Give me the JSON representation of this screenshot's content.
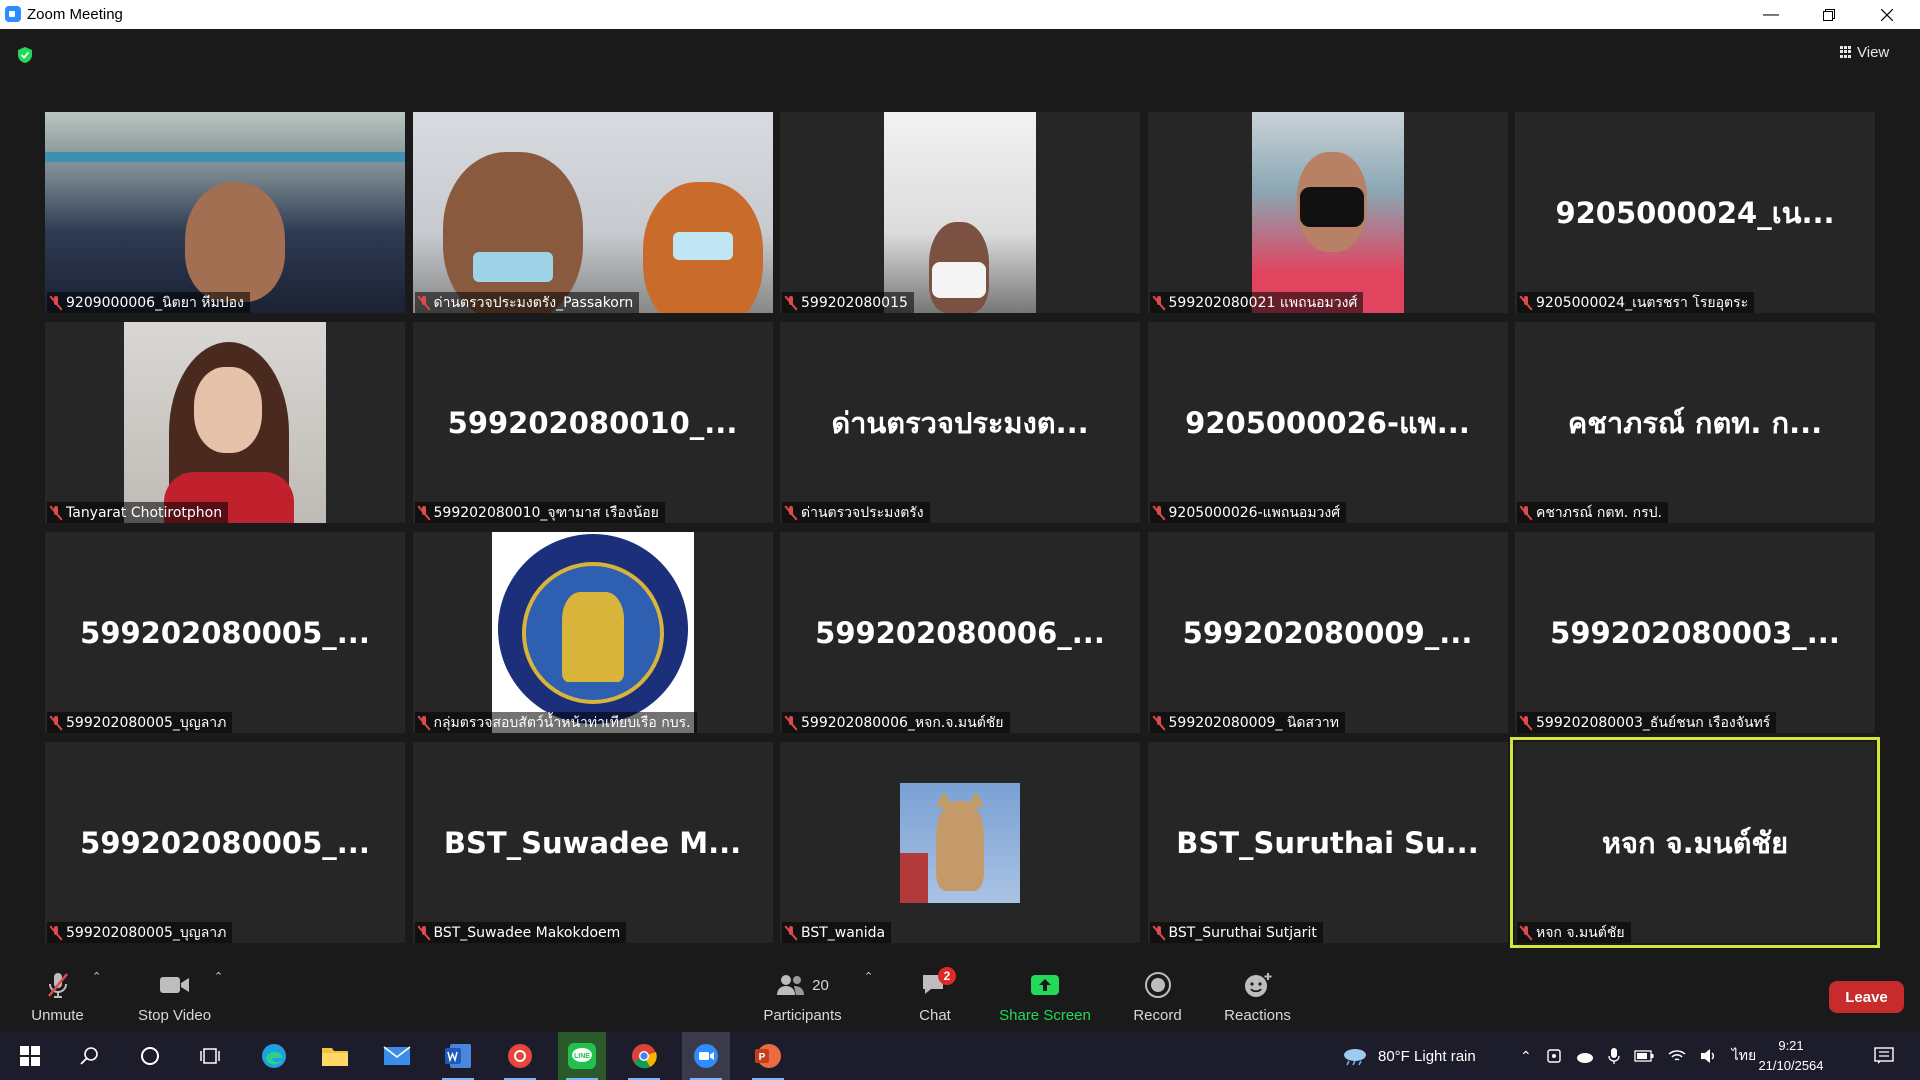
{
  "window": {
    "title": "Zoom Meeting",
    "controls": [
      "minimize",
      "restore",
      "close"
    ]
  },
  "topbar": {
    "view_label": "View"
  },
  "gallery": {
    "tiles": [
      {
        "label": "9209000006_นิตยา หีมปอง",
        "big": "",
        "video": "v1"
      },
      {
        "label": "ด่านตรวจประมงตรัง_Passakorn",
        "big": "",
        "video": "v2"
      },
      {
        "label": "599202080015",
        "big": "",
        "video": "v3"
      },
      {
        "label": "599202080021 แพถนอมวงศ์",
        "big": "",
        "video": "v4"
      },
      {
        "label": "9205000024_เนตรชรา โรยอุตระ",
        "big": "9205000024_เน...",
        "video": ""
      },
      {
        "label": "Tanyarat Chotirotphon",
        "big": "",
        "video": "v5"
      },
      {
        "label": "599202080010_จุฑามาส เรืองน้อย",
        "big": "599202080010_...",
        "video": ""
      },
      {
        "label": "ด่านตรวจประมงตรัง",
        "big": "ด่านตรวจประมงต...",
        "video": ""
      },
      {
        "label": "9205000026-แพถนอมวงศ์",
        "big": "9205000026-แพ...",
        "video": ""
      },
      {
        "label": "คชาภรณ์ กตท. กรป.",
        "big": "คชาภรณ์ กตท. ก...",
        "video": ""
      },
      {
        "label": "599202080005_บุญลาภ",
        "big": "599202080005_...",
        "video": ""
      },
      {
        "label": "กลุ่มตรวจสอบสัตว์น้ำหน้าท่าเทียบเรือ กบร.",
        "big": "",
        "video": "v6"
      },
      {
        "label": "599202080006_หจก.จ.มนต์ชัย",
        "big": "599202080006_...",
        "video": ""
      },
      {
        "label": "599202080009_ นิดสวาท",
        "big": "599202080009_...",
        "video": ""
      },
      {
        "label": "599202080003_ธันย์ชนก เรืองจันทร์",
        "big": "599202080003_...",
        "video": ""
      },
      {
        "label": "599202080005_บุญลาภ",
        "big": "599202080005_...",
        "video": ""
      },
      {
        "label": "BST_Suwadee Makokdoem",
        "big": "BST_Suwadee  M...",
        "video": ""
      },
      {
        "label": "BST_wanida",
        "big": "",
        "video": "v7"
      },
      {
        "label": "BST_Suruthai Sutjarit",
        "big": "BST_Suruthai  Su...",
        "video": ""
      },
      {
        "label": "หจก จ.มนต์ชัย",
        "big": "หจก จ.มนต์ชัย",
        "video": "",
        "active": true
      }
    ]
  },
  "toolbar": {
    "unmute": "Unmute",
    "stop_video": "Stop Video",
    "participants": "Participants",
    "participants_count": "20",
    "chat": "Chat",
    "chat_badge": "2",
    "share_screen": "Share Screen",
    "record": "Record",
    "reactions": "Reactions",
    "leave": "Leave"
  },
  "taskbar": {
    "weather": "80°F  Light rain",
    "language": "ไทย",
    "time": "9:21",
    "date": "21/10/2564"
  },
  "colors": {
    "accent_green": "#23d959",
    "leave_red": "#c72b2b",
    "active_speaker": "#d4e63e",
    "muted_red": "#e04a4a"
  }
}
